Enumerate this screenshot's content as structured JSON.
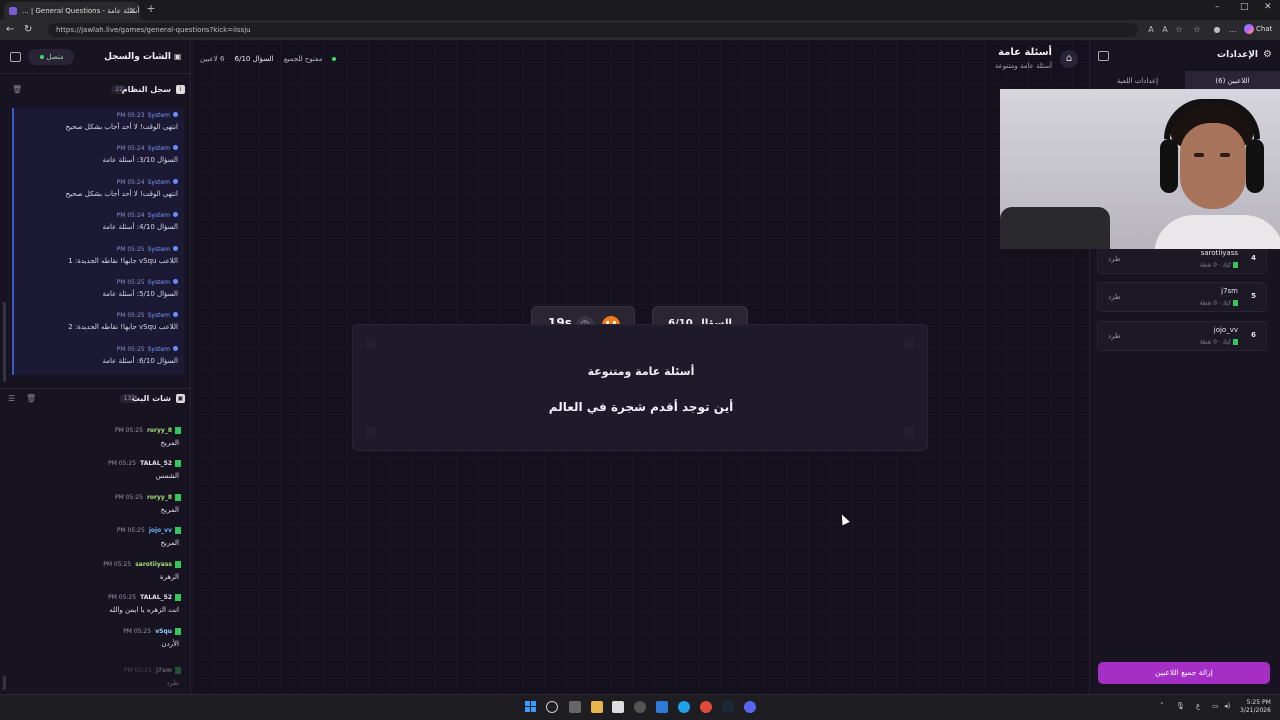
{
  "browser": {
    "tab_title": "... | General Questions - أسئلة عامة",
    "new_tab": "+",
    "url": "https://jawlah.live/games/general-questions?kick=iissju",
    "chat_label": "Chat",
    "win_min": "–",
    "win_max": "□",
    "win_close": "✕"
  },
  "left": {
    "title": "الشات والسجل",
    "online": "متصل",
    "syslog_title": "سجل النظام",
    "syslog_count": "22",
    "log": [
      {
        "time": "PM 05:23",
        "who": "System",
        "msg": "انتهى الوقت! لا أحد أجاب بشكل صحيح"
      },
      {
        "time": "PM 05:24",
        "who": "System",
        "msg": "السؤال 3/10: أسئلة عامة"
      },
      {
        "time": "PM 05:24",
        "who": "System",
        "msg": "انتهى الوقت! لا أحد أجاب بشكل صحيح"
      },
      {
        "time": "PM 05:24",
        "who": "System",
        "msg": "السؤال 4/10: أسئلة عامة"
      },
      {
        "time": "PM 05:25",
        "who": "System",
        "msg": "اللاعب vSqu جابها! نقاطه الجديدة: 1"
      },
      {
        "time": "PM 05:25",
        "who": "System",
        "msg": "السؤال 5/10: أسئلة عامة"
      },
      {
        "time": "PM 05:25",
        "who": "System",
        "msg": "اللاعب vSqu جابها! نقاطه الجديدة: 2"
      },
      {
        "time": "PM 05:25",
        "who": "System",
        "msg": "السؤال 6/10: أسئلة عامة"
      }
    ],
    "chat_title": "شات البث",
    "chat_count": "132",
    "chat": [
      {
        "time": "PM 05:25",
        "user": "roryy_8",
        "msg": "المريخ"
      },
      {
        "time": "PM 05:25",
        "user": "TALAL_52",
        "msg": "الشمس"
      },
      {
        "time": "PM 05:25",
        "user": "roryy_8",
        "msg": "المريخ"
      },
      {
        "time": "PM 05:25",
        "user": "jojo_vv",
        "msg": "المريخ"
      },
      {
        "time": "PM 05:25",
        "user": "sarotiiyass",
        "msg": "الزهرة"
      },
      {
        "time": "PM 05:25",
        "user": "TALAL_52",
        "msg": "انت الزهره يا ايمن والله"
      },
      {
        "time": "PM 05:25",
        "user": "vSqu",
        "msg": "الأردن"
      },
      {
        "time": "PM 05:25",
        "user": "j7sm",
        "msg": "طرد"
      }
    ]
  },
  "main": {
    "title": "أسئلة عامة",
    "subtitle": "أسئلة عامة ومتنوعة",
    "players_online": "6 لاعبين",
    "question_progress": "السؤال 6/10",
    "open_status": "مفتوح للجميع",
    "question_number": "السؤال 6/10",
    "timer": "19s",
    "category": "أسئلة عامة ومتنوعة",
    "question": "أين توجد أقدم شجرة في العالم"
  },
  "right": {
    "title": "الإعدادات",
    "tab_players": "اللاعبين (6)",
    "tab_game": "إعدادات اللعبة",
    "players": [
      {
        "num": "4",
        "name": "sarotiiyass",
        "sub": "كيك · 0 نقطة",
        "kick": "طرد"
      },
      {
        "num": "5",
        "name": "j7sm",
        "sub": "كيك · 0 نقطة",
        "kick": "طرد"
      },
      {
        "num": "6",
        "name": "jojo_vv",
        "sub": "كيك · 0 نقطة",
        "kick": "طرد"
      }
    ],
    "kick_all": "إزالة جميع اللاعبين"
  },
  "taskbar": {
    "time": "5:25 PM",
    "date": "3/21/2026"
  },
  "colors": {
    "accent_purple": "#a52fc4",
    "timer_orange": "#f07a1a",
    "online_green": "#3fd96b",
    "system_blue": "#3a58c8"
  }
}
